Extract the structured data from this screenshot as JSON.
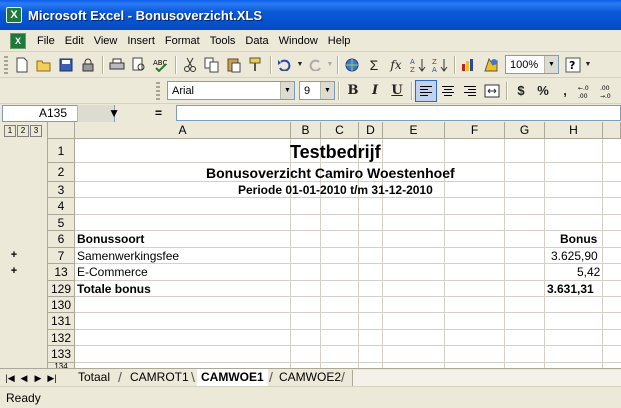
{
  "window": {
    "title": "Microsoft Excel - Bonusoverzicht.XLS",
    "app_icon": "excel-x-icon",
    "app_icon_letter": "X"
  },
  "menu": [
    "File",
    "Edit",
    "View",
    "Insert",
    "Format",
    "Tools",
    "Data",
    "Window",
    "Help"
  ],
  "toolbar": {
    "zoom": "100%",
    "font_name": "Arial",
    "font_size": "9"
  },
  "formula": {
    "name_box": "A135",
    "equals": "="
  },
  "outline_levels": [
    "1",
    "2",
    "3"
  ],
  "columns": [
    "A",
    "B",
    "C",
    "D",
    "E",
    "F",
    "G",
    "H"
  ],
  "rows": [
    "1",
    "2",
    "3",
    "4",
    "5",
    "6",
    "7",
    "13",
    "129",
    "130",
    "131",
    "132",
    "133",
    "134"
  ],
  "cells": {
    "title": "Testbedrijf",
    "subtitle": "Bonusoverzicht Camiro Woestenhoef",
    "period": "Periode 01-01-2010 t/m 31-12-2010",
    "header_left": "Bonussoort",
    "header_right": "Bonus",
    "row7_label": "Samenwerkingsfee",
    "row7_value": "3.625,90",
    "row13_label": "E-Commerce",
    "row13_value": "5,42",
    "total_label": "Totale bonus",
    "total_value": "3.631,31"
  },
  "sheet_tabs": [
    "Totaal",
    "CAMROT1",
    "CAMWOE1",
    "CAMWOE2"
  ],
  "active_tab": "CAMWOE1",
  "status": "Ready"
}
